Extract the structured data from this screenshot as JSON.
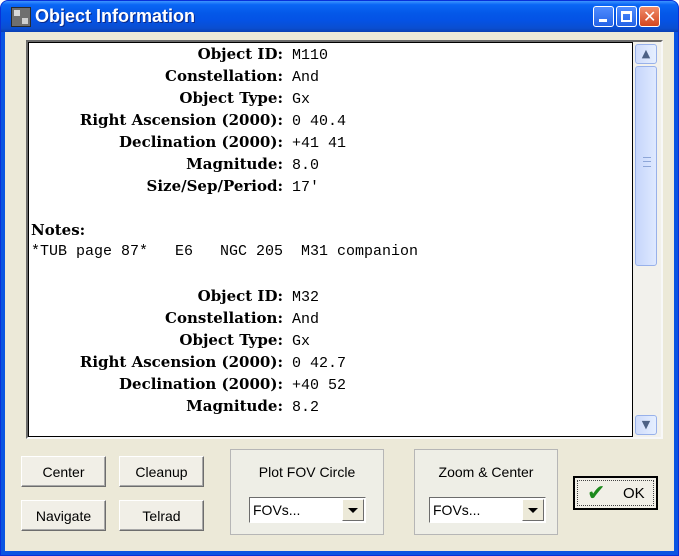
{
  "window": {
    "title": "Object Information"
  },
  "records": [
    {
      "object_id": "M110",
      "constellation": "And",
      "object_type": "Gx",
      "ra": "0 40.4",
      "dec": "+41 41",
      "magnitude": "8.0",
      "size": "17'"
    },
    {
      "object_id": "M32",
      "constellation": "And",
      "object_type": "Gx",
      "ra": "0 42.7",
      "dec": "+40 52",
      "magnitude": "8.2"
    }
  ],
  "labels": {
    "object_id": "Object ID:",
    "constellation": "Constellation:",
    "object_type": "Object Type:",
    "ra": "Right Ascension (2000):",
    "dec": "Declination (2000):",
    "magnitude": "Magnitude:",
    "size": "Size/Sep/Period:",
    "notes": "Notes:"
  },
  "notes_text": "*TUB page 87*   E6   NGC 205  M31 companion",
  "buttons": {
    "center": "Center",
    "cleanup": "Cleanup",
    "navigate": "Navigate",
    "telrad": "Telrad",
    "ok": "OK"
  },
  "plot_fov": {
    "title": "Plot FOV Circle",
    "selected": "FOVs..."
  },
  "zoom_center": {
    "title": "Zoom & Center",
    "selected": "FOVs..."
  },
  "icons": [
    "app-icon",
    "minimize-icon",
    "maximize-icon",
    "close-icon",
    "scroll-up-icon",
    "scroll-down-icon",
    "dropdown-arrow-icon",
    "checkmark-icon"
  ]
}
